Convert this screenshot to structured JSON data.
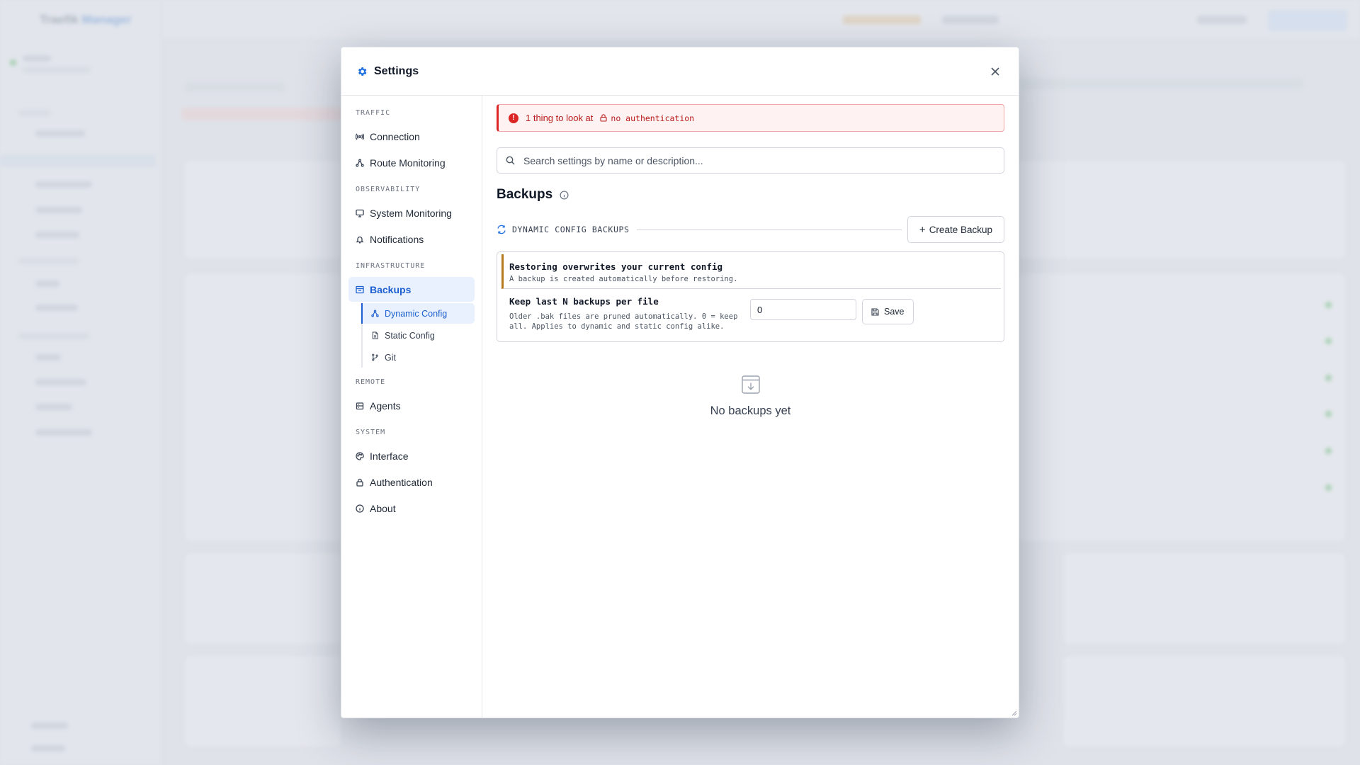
{
  "background": {
    "app_name_part1": "Traefik",
    "app_name_part2": "Manager"
  },
  "modal": {
    "title": "Settings",
    "title_icon": "gear-icon",
    "close_icon": "close-icon"
  },
  "sidebar": {
    "sections": [
      {
        "label": "TRAFFIC",
        "items": [
          {
            "label": "Connection",
            "icon": "connection-icon"
          },
          {
            "label": "Route Monitoring",
            "icon": "route-icon"
          }
        ]
      },
      {
        "label": "OBSERVABILITY",
        "items": [
          {
            "label": "System Monitoring",
            "icon": "monitor-icon"
          },
          {
            "label": "Notifications",
            "icon": "bell-icon"
          }
        ]
      },
      {
        "label": "INFRASTRUCTURE",
        "items": [
          {
            "label": "Backups",
            "icon": "backup-icon",
            "active": true,
            "children": [
              {
                "label": "Dynamic Config",
                "icon": "route-icon",
                "active": true
              },
              {
                "label": "Static Config",
                "icon": "file-icon"
              },
              {
                "label": "Git",
                "icon": "git-branch-icon"
              }
            ]
          }
        ]
      },
      {
        "label": "REMOTE",
        "items": [
          {
            "label": "Agents",
            "icon": "server-icon"
          }
        ]
      },
      {
        "label": "SYSTEM",
        "items": [
          {
            "label": "Interface",
            "icon": "palette-icon"
          },
          {
            "label": "Authentication",
            "icon": "lock-icon"
          },
          {
            "label": "About",
            "icon": "info-icon"
          }
        ]
      }
    ]
  },
  "alert": {
    "text": "1 thing to look at",
    "tag": "no authentication"
  },
  "search": {
    "placeholder": "Search settings by name or description..."
  },
  "page": {
    "title": "Backups"
  },
  "dynamic_section": {
    "label": "DYNAMIC CONFIG BACKUPS",
    "create_button": "Create Backup"
  },
  "warning": {
    "title": "Restoring overwrites your current config",
    "subtitle": "A backup is created automatically before restoring."
  },
  "retention": {
    "title": "Keep last N backups per file",
    "description": "Older .bak files are pruned automatically. 0 = keep all. Applies to dynamic and static config alike.",
    "value": "0",
    "save_button": "Save"
  },
  "empty_state": {
    "text": "No backups yet"
  },
  "colors": {
    "accent": "#1d6fe0",
    "alert_red": "#dc2626",
    "warning_amber": "#b7791f"
  }
}
